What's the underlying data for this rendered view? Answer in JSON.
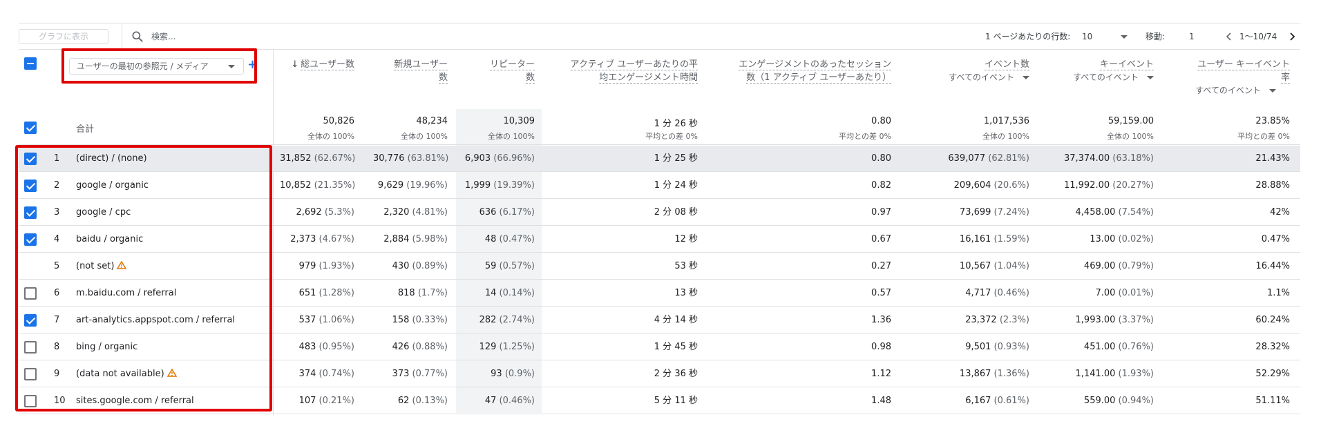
{
  "toolbar": {
    "graph_label": "グラフに表示",
    "search_placeholder": "検索...",
    "rows_per_page_label": "1 ページあたりの行数:",
    "rows_per_page_value": "10",
    "goto_label": "移動:",
    "goto_value": "1",
    "range": "1～10/74"
  },
  "dimension": {
    "label": "ユーザーの最初の参照元 / メディア"
  },
  "headers": {
    "total_users": "総ユーザー数",
    "new_users_1": "新規ユーザー",
    "new_users_2": "数",
    "repeaters_1": "リピーター",
    "repeaters_2": "数",
    "engagement_1": "アクティブ ユーザーあたりの平",
    "engagement_2": "均エンゲージメント時間",
    "sessions_1": "エンゲージメントのあったセッション",
    "sessions_2": "数（1 アクティブ ユーザーあたり）",
    "events": "イベント数",
    "events_sub": "すべてのイベント",
    "key_events": "キーイベント",
    "key_events_sub": "すべてのイベント",
    "user_key_rate_1": "ユーザー キーイベント",
    "user_key_rate_2": "率",
    "user_key_rate_sub": "すべてのイベント"
  },
  "totals": {
    "label": "合計",
    "total_users": "50,826",
    "total_users_sub": "全体の 100%",
    "new_users": "48,234",
    "new_users_sub": "全体の 100%",
    "repeaters": "10,309",
    "repeaters_sub": "全体の 100%",
    "engagement": "1 分 26 秒",
    "engagement_sub": "平均との差 0%",
    "sessions": "0.80",
    "sessions_sub": "平均との差 0%",
    "events": "1,017,536",
    "events_sub": "全体の 100%",
    "key_events": "59,159.00",
    "key_events_sub": "全体の 100%",
    "rate": "23.85%",
    "rate_sub": "平均との差 0%"
  },
  "rows": [
    {
      "checked": true,
      "num": "1",
      "name": "(direct) / (none)",
      "warn": false,
      "tu": "31,852",
      "tu_p": "(62.67%)",
      "nu": "30,776",
      "nu_p": "(63.81%)",
      "rp": "6,903",
      "rp_p": "(66.96%)",
      "eng": "1 分 25 秒",
      "ses": "0.80",
      "ev": "639,077",
      "ev_p": "(62.81%)",
      "ke": "37,374.00",
      "ke_p": "(63.18%)",
      "rate": "21.43%"
    },
    {
      "checked": true,
      "num": "2",
      "name": "google / organic",
      "warn": false,
      "tu": "10,852",
      "tu_p": "(21.35%)",
      "nu": "9,629",
      "nu_p": "(19.96%)",
      "rp": "1,999",
      "rp_p": "(19.39%)",
      "eng": "1 分 24 秒",
      "ses": "0.82",
      "ev": "209,604",
      "ev_p": "(20.6%)",
      "ke": "11,992.00",
      "ke_p": "(20.27%)",
      "rate": "28.88%"
    },
    {
      "checked": true,
      "num": "3",
      "name": "google / cpc",
      "warn": false,
      "tu": "2,692",
      "tu_p": "(5.3%)",
      "nu": "2,320",
      "nu_p": "(4.81%)",
      "rp": "636",
      "rp_p": "(6.17%)",
      "eng": "2 分 08 秒",
      "ses": "0.97",
      "ev": "73,699",
      "ev_p": "(7.24%)",
      "ke": "4,458.00",
      "ke_p": "(7.54%)",
      "rate": "42%"
    },
    {
      "checked": true,
      "num": "4",
      "name": "baidu / organic",
      "warn": false,
      "tu": "2,373",
      "tu_p": "(4.67%)",
      "nu": "2,884",
      "nu_p": "(5.98%)",
      "rp": "48",
      "rp_p": "(0.47%)",
      "eng": "12 秒",
      "ses": "0.67",
      "ev": "16,161",
      "ev_p": "(1.59%)",
      "ke": "13.00",
      "ke_p": "(0.02%)",
      "rate": "0.47%"
    },
    {
      "checked": null,
      "num": "5",
      "name": "(not set)",
      "warn": true,
      "tu": "979",
      "tu_p": "(1.93%)",
      "nu": "430",
      "nu_p": "(0.89%)",
      "rp": "59",
      "rp_p": "(0.57%)",
      "eng": "53 秒",
      "ses": "0.27",
      "ev": "10,567",
      "ev_p": "(1.04%)",
      "ke": "469.00",
      "ke_p": "(0.79%)",
      "rate": "16.44%"
    },
    {
      "checked": false,
      "num": "6",
      "name": "m.baidu.com / referral",
      "warn": false,
      "tu": "651",
      "tu_p": "(1.28%)",
      "nu": "818",
      "nu_p": "(1.7%)",
      "rp": "14",
      "rp_p": "(0.14%)",
      "eng": "13 秒",
      "ses": "0.57",
      "ev": "4,717",
      "ev_p": "(0.46%)",
      "ke": "7.00",
      "ke_p": "(0.01%)",
      "rate": "1.1%"
    },
    {
      "checked": true,
      "num": "7",
      "name": "art-analytics.appspot.com / referral",
      "warn": false,
      "tu": "537",
      "tu_p": "(1.06%)",
      "nu": "158",
      "nu_p": "(0.33%)",
      "rp": "282",
      "rp_p": "(2.74%)",
      "eng": "4 分 14 秒",
      "ses": "1.36",
      "ev": "23,372",
      "ev_p": "(2.3%)",
      "ke": "1,993.00",
      "ke_p": "(3.37%)",
      "rate": "60.24%"
    },
    {
      "checked": false,
      "num": "8",
      "name": "bing / organic",
      "warn": false,
      "tu": "483",
      "tu_p": "(0.95%)",
      "nu": "426",
      "nu_p": "(0.88%)",
      "rp": "129",
      "rp_p": "(1.25%)",
      "eng": "1 分 45 秒",
      "ses": "0.98",
      "ev": "9,501",
      "ev_p": "(0.93%)",
      "ke": "451.00",
      "ke_p": "(0.76%)",
      "rate": "28.32%"
    },
    {
      "checked": false,
      "num": "9",
      "name": "(data not available)",
      "warn": true,
      "tu": "374",
      "tu_p": "(0.74%)",
      "nu": "373",
      "nu_p": "(0.77%)",
      "rp": "93",
      "rp_p": "(0.9%)",
      "eng": "2 分 36 秒",
      "ses": "1.12",
      "ev": "13,867",
      "ev_p": "(1.36%)",
      "ke": "1,141.00",
      "ke_p": "(1.93%)",
      "rate": "52.29%"
    },
    {
      "checked": false,
      "num": "10",
      "name": "sites.google.com / referral",
      "warn": false,
      "tu": "107",
      "tu_p": "(0.21%)",
      "nu": "62",
      "nu_p": "(0.13%)",
      "rp": "47",
      "rp_p": "(0.46%)",
      "eng": "5 分 11 秒",
      "ses": "1.48",
      "ev": "6,167",
      "ev_p": "(0.61%)",
      "ke": "559.00",
      "ke_p": "(0.94%)",
      "rate": "51.11%"
    }
  ],
  "colors": {
    "accent": "#1a73e8",
    "highlight": "#e00000",
    "warning": "#e37400"
  },
  "icons": {
    "search": "search-icon",
    "prev": "chevron-left-icon",
    "next": "chevron-right-icon",
    "add": "plus-icon",
    "warning": "warning-icon"
  }
}
